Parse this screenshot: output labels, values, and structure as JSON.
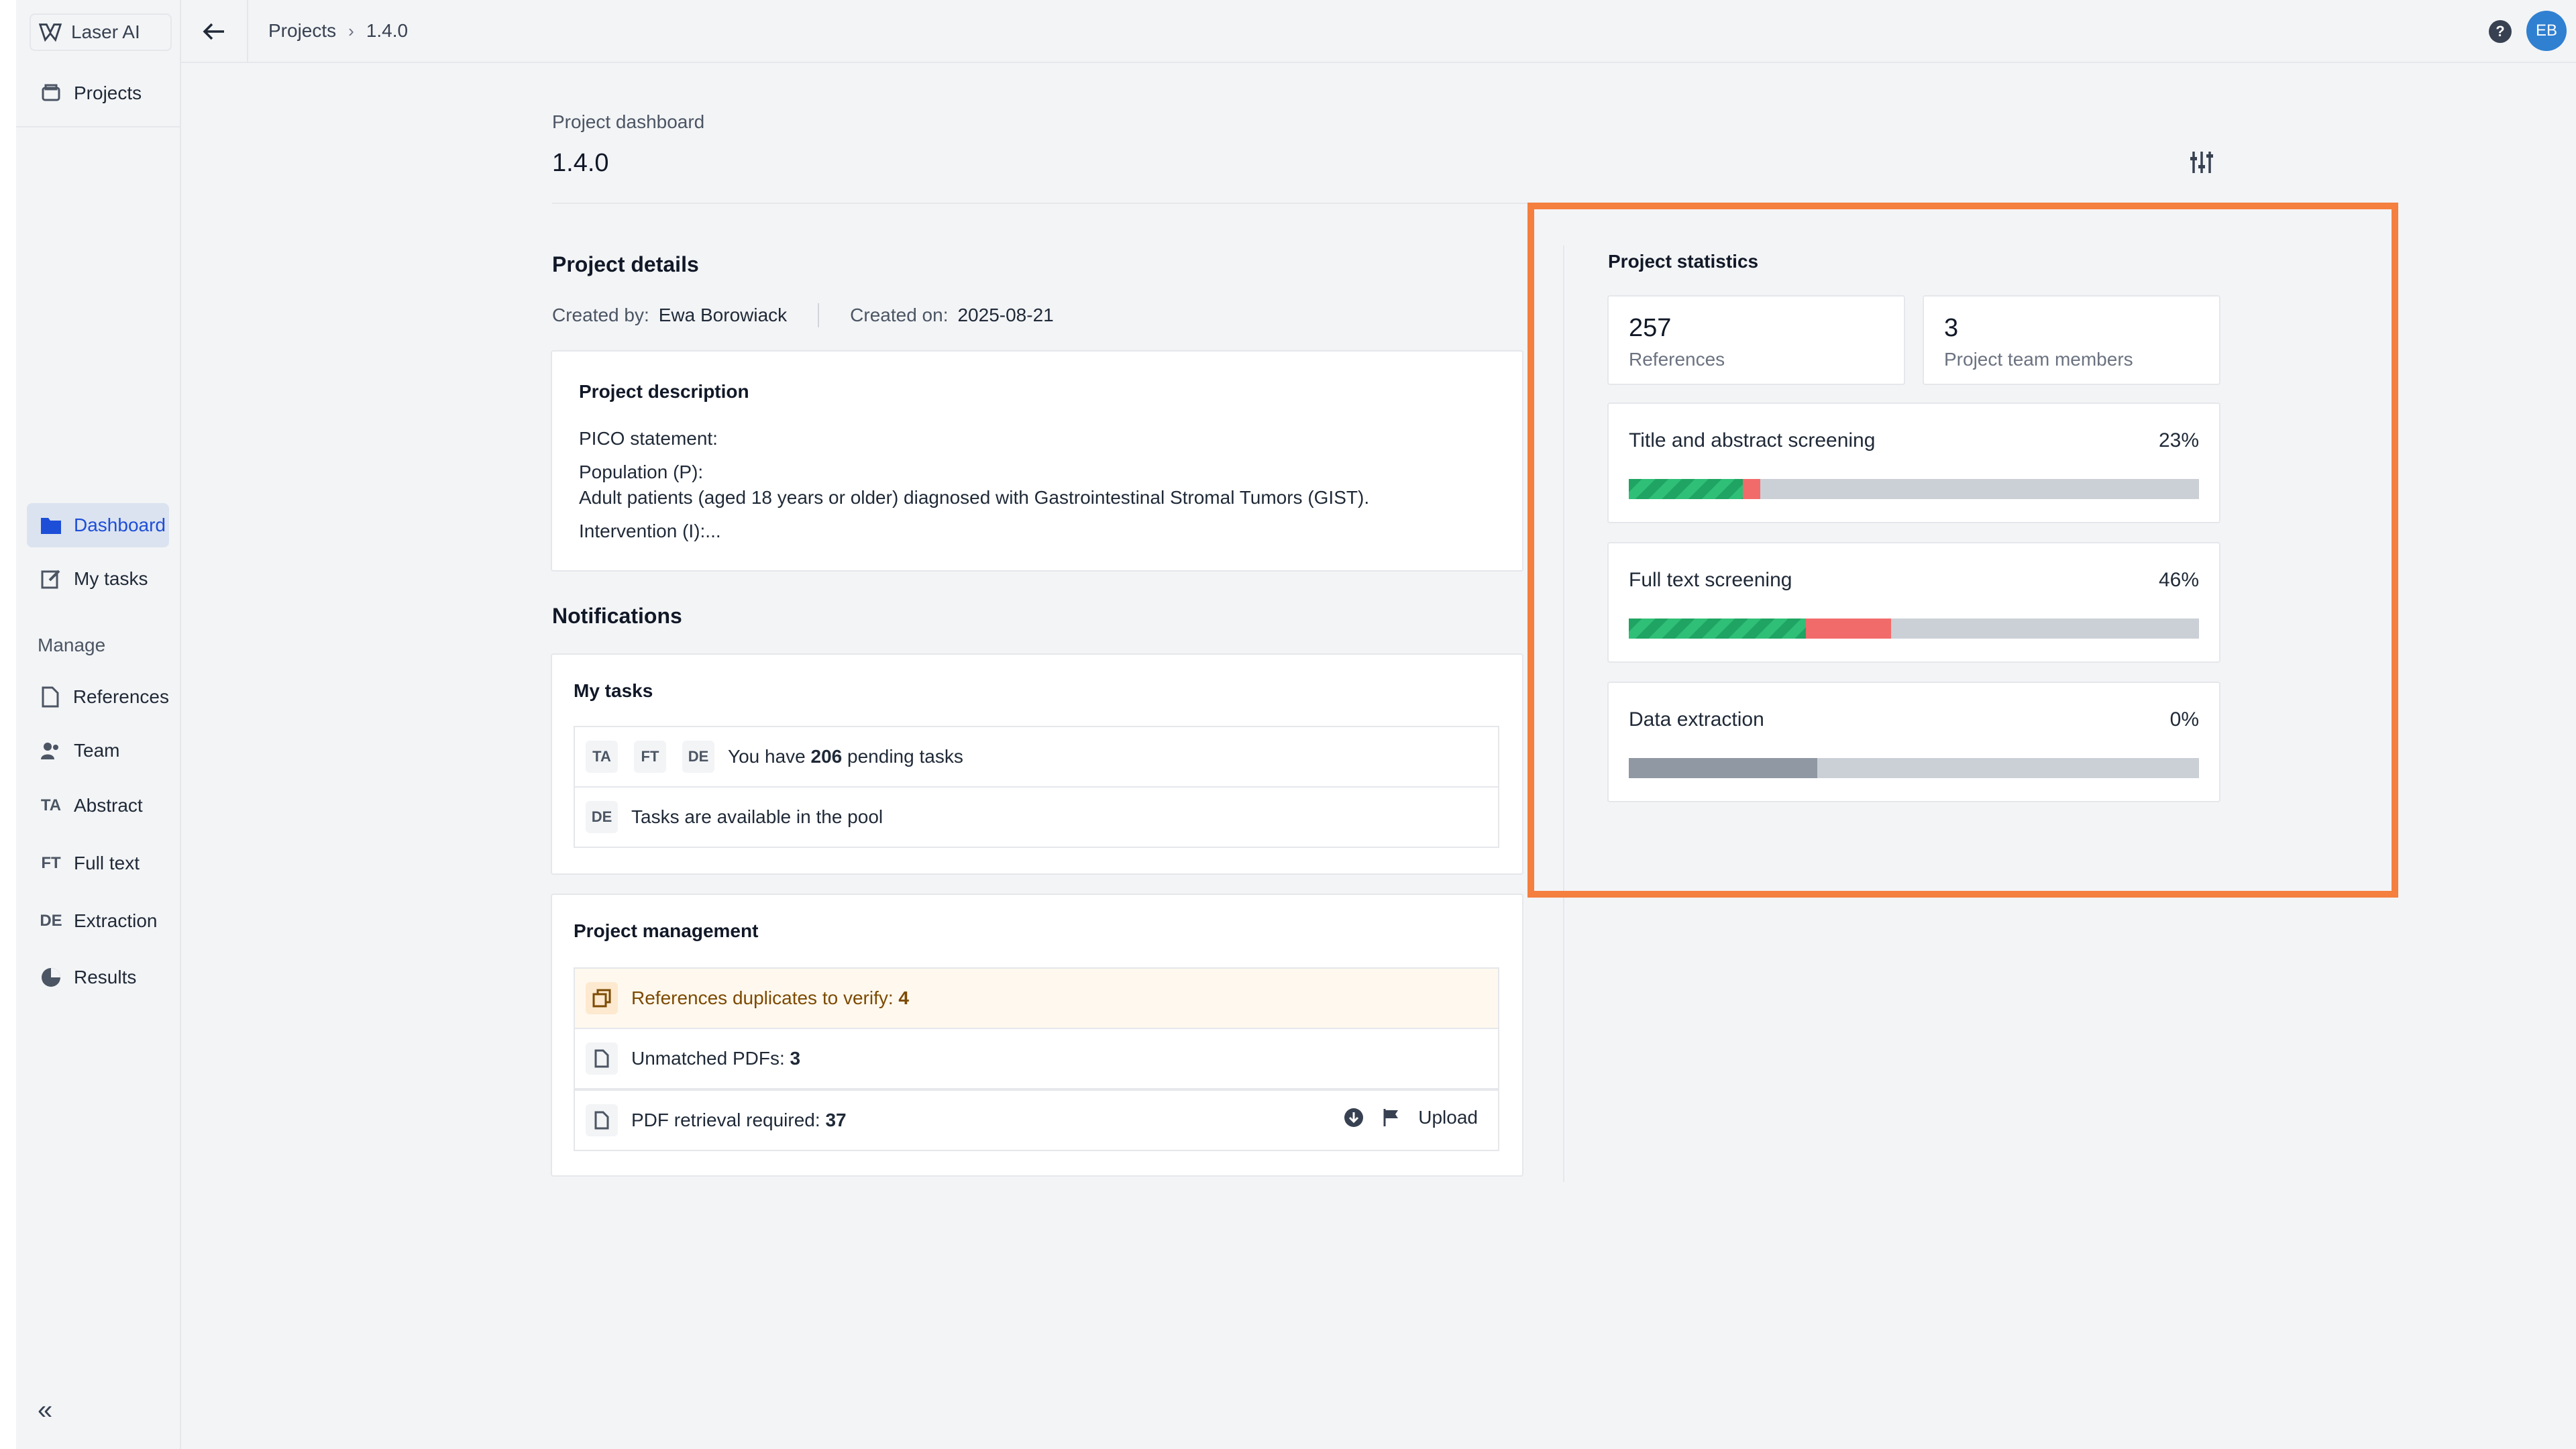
{
  "app": {
    "name": "Laser AI"
  },
  "sidebar": {
    "top_items": [
      {
        "label": "Projects",
        "icon": "projects-icon"
      }
    ],
    "nav_items": [
      {
        "label": "Dashboard",
        "icon": "folder-icon",
        "active": true
      },
      {
        "label": "My tasks",
        "icon": "edit-icon"
      }
    ],
    "manage_label": "Manage",
    "manage_items": [
      {
        "label": "References",
        "icon": "file-icon"
      },
      {
        "label": "Team",
        "icon": "team-icon"
      },
      {
        "label": "Abstract",
        "icon": "ta-icon",
        "abbr": "TA"
      },
      {
        "label": "Full text",
        "icon": "ft-icon",
        "abbr": "FT"
      },
      {
        "label": "Extraction",
        "icon": "de-icon",
        "abbr": "DE"
      },
      {
        "label": "Results",
        "icon": "results-icon"
      }
    ],
    "collapse_glyph": "«"
  },
  "topbar": {
    "breadcrumb": [
      "Projects",
      "1.4.0"
    ],
    "help_glyph": "?",
    "user_initials": "EB"
  },
  "page": {
    "subtitle": "Project dashboard",
    "title": "1.4.0"
  },
  "project_details": {
    "heading": "Project details",
    "created_by_label": "Created by:",
    "created_by": "Ewa Borowiack",
    "created_on_label": "Created on:",
    "created_on": "2025-08-21",
    "description": {
      "heading": "Project description",
      "lines": [
        "PICO statement:",
        "Population (P):",
        "Adult patients (aged 18 years or older) diagnosed with Gastrointestinal Stromal Tumors (GIST).",
        "Intervention (I):..."
      ]
    }
  },
  "notifications": {
    "heading": "Notifications",
    "my_tasks": {
      "heading": "My tasks",
      "row1": {
        "tags": [
          "TA",
          "FT",
          "DE"
        ],
        "prefix": "You have",
        "count": "206",
        "suffix": "pending tasks"
      },
      "row2": {
        "tags": [
          "DE"
        ],
        "text": "Tasks are available in the pool"
      }
    },
    "project_management": {
      "heading": "Project management",
      "duplicates": {
        "label": "References duplicates to verify:",
        "value": "4"
      },
      "unmatched": {
        "label": "Unmatched PDFs:",
        "value": "3"
      },
      "retrieval": {
        "label": "PDF retrieval required:",
        "value": "37",
        "upload_label": "Upload"
      }
    }
  },
  "statistics": {
    "heading": "Project statistics",
    "references": {
      "value": "257",
      "label": "References"
    },
    "team": {
      "value": "3",
      "label": "Project team members"
    },
    "progress": [
      {
        "label": "Title and abstract screening",
        "percent": "23%",
        "green": 0.2,
        "red": 0.03,
        "gray": 0
      },
      {
        "label": "Full text screening",
        "percent": "46%",
        "green": 0.31,
        "red": 0.15,
        "gray": 0
      },
      {
        "label": "Data extraction",
        "percent": "0%",
        "green": 0,
        "red": 0,
        "gray": 0.33
      }
    ]
  },
  "colors": {
    "accent": "#1d4ed8",
    "highlight": "#f47f3e",
    "progress_green": "#1fa463",
    "progress_red": "#f26b6b",
    "avatar": "#2f80d1"
  }
}
